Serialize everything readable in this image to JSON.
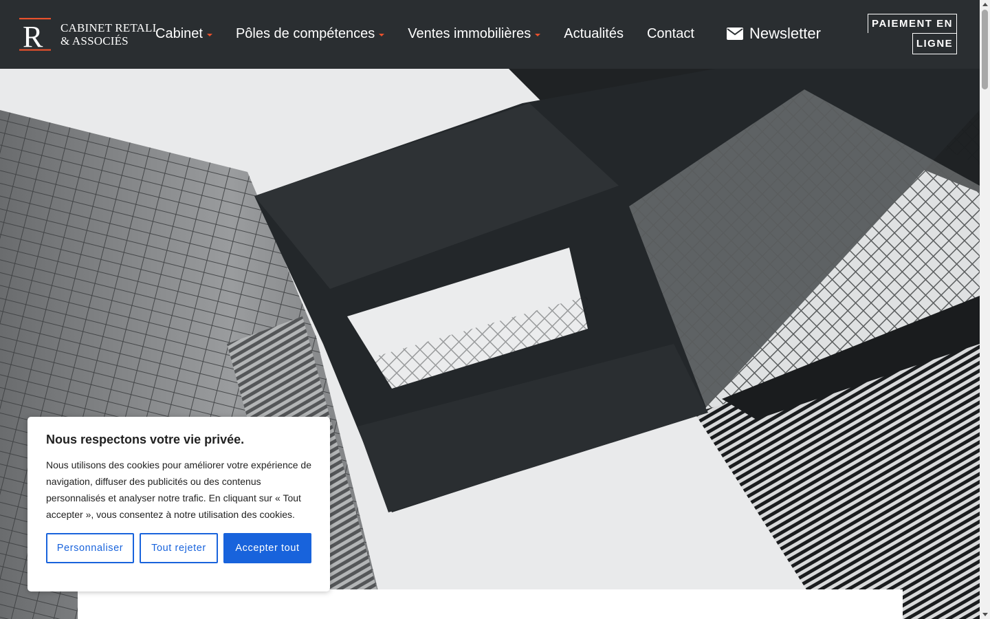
{
  "brand": {
    "logo_line1": "CABINET RETALI",
    "logo_line2": "& ASSOCIÉS",
    "logo_letter": "R",
    "accent_color": "#e8512c"
  },
  "nav": {
    "items": [
      {
        "label": "Cabinet",
        "has_dropdown": true
      },
      {
        "label": "Pôles de compétences",
        "has_dropdown": true
      },
      {
        "label": "Ventes immobilières",
        "has_dropdown": true
      },
      {
        "label": "Actualités",
        "has_dropdown": false
      },
      {
        "label": "Contact",
        "has_dropdown": false
      }
    ],
    "newsletter_label": "Newsletter",
    "newsletter_icon": "envelope-icon",
    "payment_line1": "PAIEMENT EN",
    "payment_line2": "LIGNE"
  },
  "cookie_banner": {
    "title": "Nous respectons votre vie privée.",
    "text": "Nous utilisons des cookies pour améliorer votre expérience de navigation, diffuser des publicités ou des contenus personnalisés et analyser notre trafic. En cliquant sur « Tout accepter », vous consentez à notre utilisation des cookies.",
    "customize_label": "Personnaliser",
    "reject_label": "Tout rejeter",
    "accept_label": "Accepter tout",
    "button_color": "#1863dc"
  },
  "colors": {
    "header_bg": "#2a2e31",
    "hero_sky": "#e9eaeb"
  }
}
